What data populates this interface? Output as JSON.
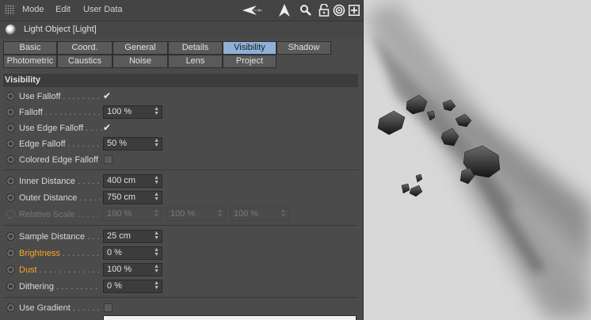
{
  "menu": {
    "mode": "Mode",
    "edit": "Edit",
    "user_data": "User Data"
  },
  "title": "Light Object [Light]",
  "tabs_row1": [
    {
      "label": "Basic",
      "active": false
    },
    {
      "label": "Coord.",
      "active": false
    },
    {
      "label": "General",
      "active": false
    },
    {
      "label": "Details",
      "active": false
    },
    {
      "label": "Visibility",
      "active": true
    },
    {
      "label": "Shadow",
      "active": false
    }
  ],
  "tabs_row2": [
    {
      "label": "Photometric"
    },
    {
      "label": "Caustics"
    },
    {
      "label": "Noise"
    },
    {
      "label": "Lens"
    },
    {
      "label": "Project"
    }
  ],
  "section": "Visibility",
  "props": {
    "use_falloff": {
      "label": "Use Falloff",
      "dots": " . . . . . . . . ",
      "checked": true
    },
    "falloff": {
      "label": "Falloff",
      "dots": " . . . . . . . . . . . . ",
      "value": "100 %"
    },
    "use_edge_falloff": {
      "label": "Use Edge Falloff",
      "dots": " . . . .",
      "checked": true
    },
    "edge_falloff": {
      "label": "Edge Falloff",
      "dots": " . . . . . . .",
      "value": "50 %"
    },
    "colored_edge_falloff": {
      "label": "Colored Edge Falloff",
      "checked": false
    },
    "inner_distance": {
      "label": "Inner Distance",
      "dots": " . . . . .",
      "value": "400 cm"
    },
    "outer_distance": {
      "label": "Outer Distance",
      "dots": " . . . . .",
      "value": "750 cm"
    },
    "relative_scale": {
      "label": "Relative Scale",
      "dots": " . . . . .",
      "values": [
        "100 %",
        "100 %",
        "100 %"
      ]
    },
    "sample_distance": {
      "label": "Sample Distance",
      "dots": " . . . .",
      "value": "25 cm"
    },
    "brightness": {
      "label": "Brightness",
      "dots": " . . . . . . . .",
      "value": "0 %"
    },
    "dust": {
      "label": "Dust",
      "dots": " . . . . . . . . . . . . . .",
      "value": "100 %"
    },
    "dithering": {
      "label": "Dithering",
      "dots": " . . . . . . . . .",
      "value": "0 %"
    },
    "use_gradient": {
      "label": "Use Gradient",
      "dots": " . . . . . .",
      "checked": false
    }
  },
  "colors": {
    "active_tab": "#8fb0d8",
    "animated_label": "#f5a623",
    "panel_bg": "#4b4b4b",
    "viewport_bg": "#d4d4d4"
  },
  "toolbar_icons": [
    "arrow-left-icon",
    "arrow-up-icon",
    "search-icon",
    "lock-icon",
    "target-icon",
    "new-window-icon"
  ]
}
